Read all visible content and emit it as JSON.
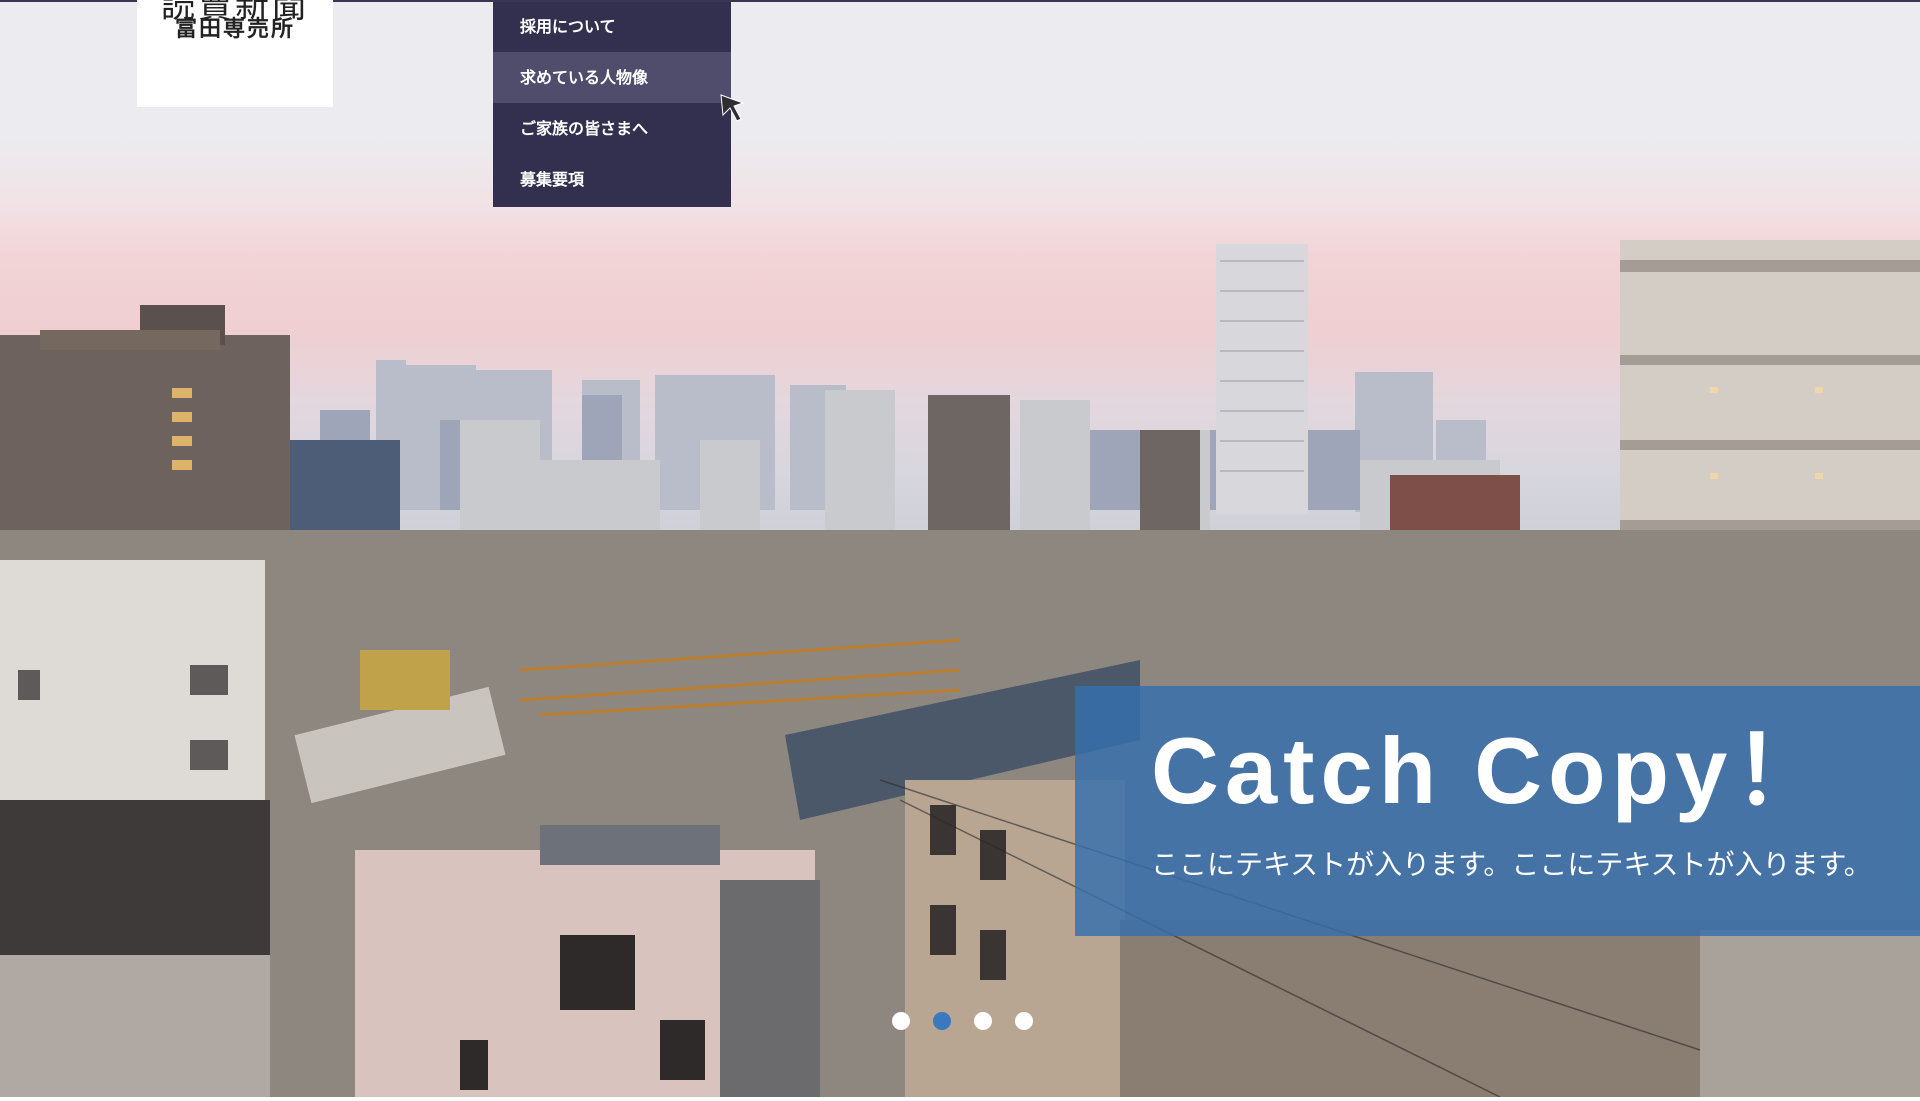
{
  "logo": {
    "line1": "読賣新聞",
    "line2": "富田専売所"
  },
  "dropdown": {
    "items": [
      {
        "label": "採用について"
      },
      {
        "label": "求めている人物像"
      },
      {
        "label": "ご家族の皆さまへ"
      },
      {
        "label": "募集要項"
      }
    ],
    "active_index": 1
  },
  "hero": {
    "catch_title": "Catch Copy！",
    "catch_text": "ここにテキストが入ります。ここにテキストが入ります。"
  },
  "slider": {
    "slide_count": 4,
    "active_index": 1
  },
  "colors": {
    "menu_bg": "#33304f",
    "menu_active": "#4f4c6c",
    "catch_bg": "#346fad",
    "dot_active": "#3a78bf"
  }
}
